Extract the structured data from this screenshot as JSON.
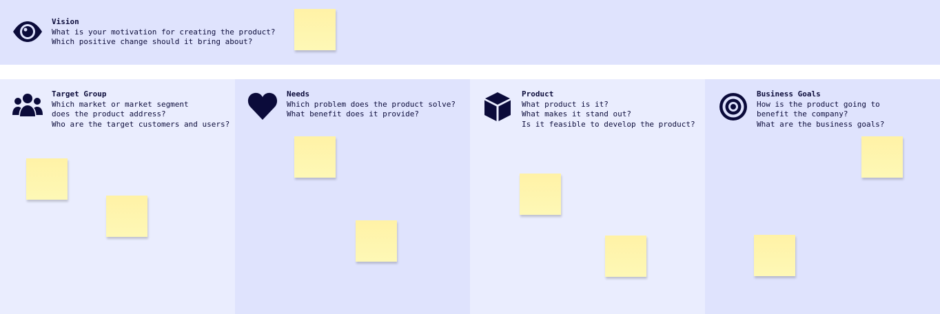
{
  "vision": {
    "title": "Vision",
    "lines": [
      "What is your motivation for creating the product?",
      "Which positive change should it bring about?"
    ],
    "icon": "eye-icon"
  },
  "sections": [
    {
      "title": "Target Group",
      "lines": [
        "Which market or market segment",
        "does the product address?",
        "Who are the target customers and users?"
      ],
      "icon": "users-icon"
    },
    {
      "title": "Needs",
      "lines": [
        "Which problem does the product solve?",
        "What benefit does it provide?"
      ],
      "icon": "heart-icon"
    },
    {
      "title": "Product",
      "lines": [
        "What product is it?",
        "What makes it stand out?",
        "Is it feasible to develop the product?"
      ],
      "icon": "cube-icon"
    },
    {
      "title": "Business Goals",
      "lines": [
        "How is the product going to",
        "benefit the company?",
        "What are the business goals?"
      ],
      "icon": "target-icon"
    }
  ],
  "colors": {
    "vision_bg": "#dfe3fd",
    "light_bg": "#eaedfe",
    "dark_bg": "#dfe3fd",
    "ink": "#0b0b3a",
    "sticky": "#fff5ad"
  }
}
